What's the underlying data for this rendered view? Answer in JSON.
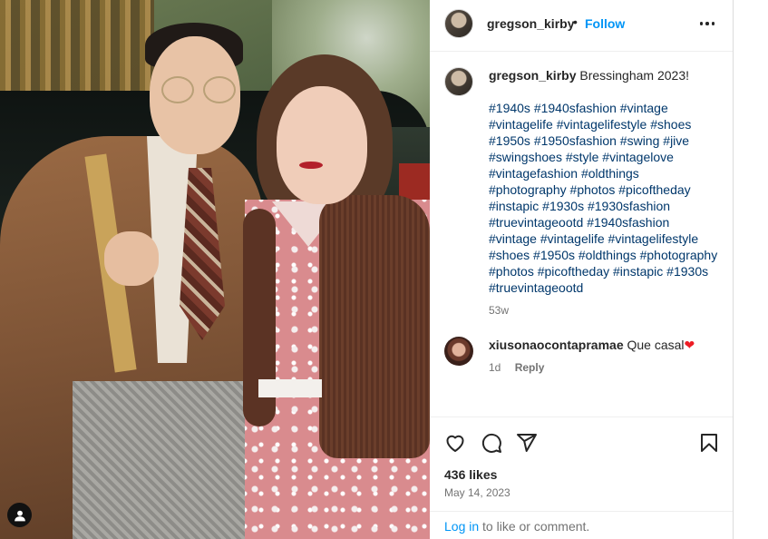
{
  "post": {
    "username": "gregson_kirby",
    "separator": "•",
    "follow_label": "Follow",
    "caption_text": "Bressingham 2023!",
    "hashtags": [
      "#1940s",
      "#1940sfashion",
      "#vintage",
      "#vintagelife",
      "#vintagelifestyle",
      "#shoes",
      "#1950s",
      "#1950sfashion",
      "#swing",
      "#jive",
      "#swingshoes",
      "#style",
      "#vintagelove",
      "#vintagefashion",
      "#oldthings",
      "#photography",
      "#photos",
      "#picoftheday",
      "#instapic",
      "#1930s",
      "#1930sfashion",
      "#truevintageootd",
      "#1940sfashion",
      "#vintage",
      "#vintagelife",
      "#vintagelifestyle",
      "#shoes",
      "#1950s",
      "#oldthings",
      "#photography",
      "#photos",
      "#picoftheday",
      "#instapic",
      "#1930s",
      "#truevintageootd"
    ],
    "caption_age": "53w"
  },
  "comment": {
    "username": "xiusonaocontapramae",
    "text": "Que casal",
    "heart": "❤",
    "age": "1d",
    "reply_label": "Reply"
  },
  "engagement": {
    "likes": "436 likes",
    "date": "May 14, 2023"
  },
  "login": {
    "link_label": "Log in",
    "rest": " to like or comment."
  },
  "icons": {
    "more": "more-options-icon",
    "like": "heart-icon",
    "comment": "comment-icon",
    "share": "share-icon",
    "save": "bookmark-icon",
    "tagged_user": "user-icon"
  },
  "colors": {
    "link": "#0095f6",
    "hashtag": "#00376b",
    "muted": "#737373",
    "text": "#262626"
  }
}
